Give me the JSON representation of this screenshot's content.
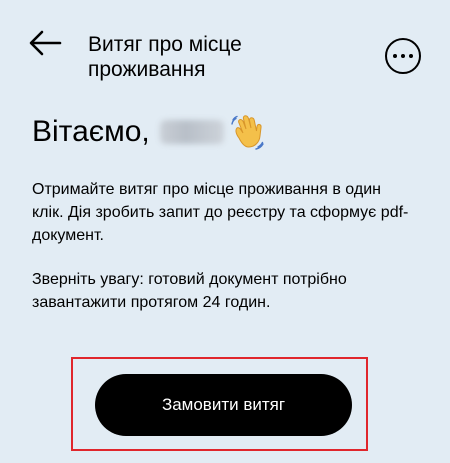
{
  "header": {
    "title": "Витяг про місце проживання",
    "back_icon": "arrow-left-icon",
    "menu_icon": "more-horizontal-icon"
  },
  "greeting": {
    "text": "Вітаємо,",
    "wave_icon": "waving-hand-icon"
  },
  "info": {
    "paragraph1": "Отримайте витяг про місце проживання в один клік. Дія зробить запит до реєстру та сформує pdf-документ.",
    "paragraph2": "Зверніть увагу: готовий документ потрібно завантажити протягом 24 годин."
  },
  "actions": {
    "order_label": "Замовити витяг"
  },
  "colors": {
    "background": "#e2ecf4",
    "button": "#000000",
    "button_text": "#ffffff",
    "highlight": "#e0262c",
    "wave_hand": "#f4c04a"
  }
}
